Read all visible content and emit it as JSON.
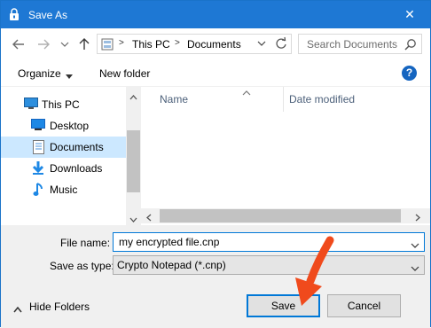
{
  "window": {
    "title": "Save As",
    "close_glyph": "✕"
  },
  "address_bar": {
    "crumbs": [
      "This PC",
      "Documents"
    ],
    "separator": ">",
    "search_placeholder": "Search Documents"
  },
  "toolbar": {
    "organize_label": "Organize",
    "new_folder_label": "New folder",
    "help_glyph": "?"
  },
  "nav_pane": {
    "items": [
      {
        "label": "This PC",
        "icon": "computer-icon",
        "selected": false
      },
      {
        "label": "Desktop",
        "icon": "desktop-icon",
        "selected": false
      },
      {
        "label": "Documents",
        "icon": "documents-icon",
        "selected": true
      },
      {
        "label": "Downloads",
        "icon": "downloads-icon",
        "selected": false
      },
      {
        "label": "Music",
        "icon": "music-icon",
        "selected": false
      }
    ]
  },
  "file_list": {
    "columns": [
      "Name",
      "Date modified"
    ]
  },
  "form": {
    "file_name_label": "File name:",
    "file_name_value": "my encrypted file.cnp",
    "save_type_label": "Save as type:",
    "save_type_value": "Crypto Notepad (*.cnp)",
    "hide_folders_label": "Hide Folders",
    "save_label": "Save",
    "cancel_label": "Cancel"
  },
  "colors": {
    "titlebar": "#1e78d4",
    "selection": "#cce8ff",
    "annotation_arrow": "#f04a1c"
  }
}
